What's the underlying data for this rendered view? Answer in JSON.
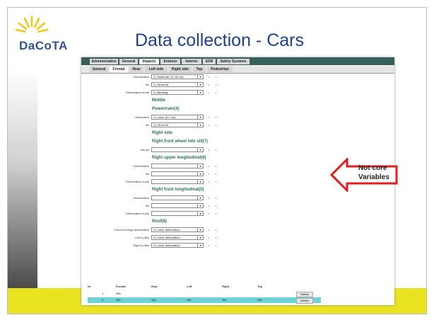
{
  "logo": {
    "text": "DaCoTA"
  },
  "slide": {
    "title": "Data collection - Cars"
  },
  "app": {
    "top_tabs": [
      {
        "label": "Administration",
        "active": false
      },
      {
        "label": "General",
        "active": false
      },
      {
        "label": "Impacts",
        "active": true
      },
      {
        "label": "Exterior",
        "active": false
      },
      {
        "label": "Interior",
        "active": false
      },
      {
        "label": "EDR",
        "active": false
      },
      {
        "label": "Safety Systems",
        "active": false
      }
    ],
    "sub_tabs": [
      {
        "label": "General",
        "active": false
      },
      {
        "label": "Frontal",
        "active": true
      },
      {
        "label": "Rear",
        "active": false
      },
      {
        "label": "Left side",
        "active": false
      },
      {
        "label": "Right side",
        "active": false
      },
      {
        "label": "Top",
        "active": false
      },
      {
        "label": "Pedestrian",
        "active": false
      }
    ],
    "form": {
      "rows": [
        {
          "type": "field",
          "label": "Deformation",
          "value": "2 | Moderate (11-30 cm)"
        },
        {
          "type": "field",
          "label": "Ies",
          "value": "3 | Direct hit"
        },
        {
          "type": "field",
          "label": "Deformation mode",
          "value": "3 | Bending"
        },
        {
          "type": "section",
          "label": "Middle"
        },
        {
          "type": "section",
          "label": "Powertrain(4)"
        },
        {
          "type": "field",
          "label": "Dislocation",
          "value": "3 | minor (0-2 cm)"
        },
        {
          "type": "field",
          "label": "Ies",
          "value": "3 | Direct hit"
        },
        {
          "type": "section",
          "label": "Right side"
        },
        {
          "type": "section",
          "label": "Right front wheel into sill(7)"
        },
        {
          "type": "field",
          "label": "into sill",
          "value": ""
        },
        {
          "type": "section",
          "label": "Right upper longitudinal(6)"
        },
        {
          "type": "field",
          "label": "Deformation",
          "value": ""
        },
        {
          "type": "field",
          "label": "Ies",
          "value": ""
        },
        {
          "type": "field",
          "label": "Deformation mode",
          "value": ""
        },
        {
          "type": "section",
          "label": "Right front longitudinal(5)"
        },
        {
          "type": "field",
          "label": "Deformation",
          "value": ""
        },
        {
          "type": "field",
          "label": "Ies",
          "value": ""
        },
        {
          "type": "field",
          "label": "Deformation mode",
          "value": ""
        },
        {
          "type": "section",
          "label": "Roof(8)"
        },
        {
          "type": "field",
          "label": "Front roof edge deformation",
          "value": "3 | minor deformation"
        },
        {
          "type": "field",
          "label": "Left A-pillar",
          "value": "3 | minor deformation"
        },
        {
          "type": "field",
          "label": "Right A-pillar",
          "value": "3 | minor deformation"
        }
      ]
    },
    "table": {
      "headers": [
        "Nr",
        "Frontal",
        "Rear",
        "Left",
        "Right",
        "Top"
      ],
      "rows": [
        {
          "nr": "1",
          "frontal": "Yes",
          "rear": "",
          "left": "",
          "right": "",
          "top": "",
          "action": "Delete"
        },
        {
          "nr": "2",
          "frontal": "Yes",
          "rear": "Yes",
          "left": "Yes",
          "right": "Yes",
          "top": "Yes",
          "action": "Delete"
        }
      ]
    }
  },
  "callout": {
    "line1": "Not core",
    "line2": "Variables"
  },
  "colors": {
    "band": "#e9e321",
    "title": "#1f3f8f",
    "tabbar": "#365f59",
    "highlight": "#6fd3d6",
    "arrow": "#e11d1d"
  },
  "icons": {
    "logo": "sun-rays-icon",
    "arrow": "left-arrow-icon",
    "dropdown": "chevron-down-icon"
  }
}
